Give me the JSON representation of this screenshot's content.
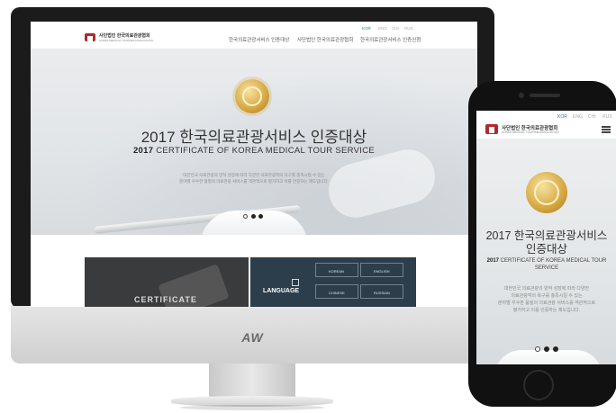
{
  "site": {
    "logo_text": "사단법인 한국의료관광협회",
    "logo_sub": "KOREA MEDICAL TOURISM ASSOCIATION"
  },
  "desktop": {
    "languages": [
      "KOR",
      "ENG",
      "CHI",
      "RUS"
    ],
    "nav": [
      "한국의료관광서비스 인증대상",
      "사단법인 한국의료관광협회",
      "한국의료관광서비스 인증신청"
    ],
    "hero": {
      "title": "2017 한국의료관광서비스 인증대상",
      "subtitle_year": "2017",
      "subtitle": "CERTIFICATE OF KOREA MEDICAL TOUR SERVICE",
      "desc_line1": "대한민국 의료관광의 양적 성장에 따라 다양한 의료관광객의 욕구를 충족시킬 수 있는",
      "desc_line2": "분야별 우수한 품질의 의료관광 서비스를 객관적으로 평가하고 이를 인증하는 제도입니다."
    },
    "tiles": {
      "left_label": "CERTIFICATE",
      "language_title": "LANGUAGE",
      "language_options": [
        "KOREAN",
        "ENGLISH",
        "CHINESE",
        "RUSSIAN"
      ]
    }
  },
  "monitor_logo": "AW",
  "phone": {
    "languages": [
      "KOR",
      "ENG",
      "CHI",
      "RUS"
    ],
    "hero": {
      "title_line1": "2017 한국의료관광서비스",
      "title_line2": "인증대상",
      "subtitle_year": "2017",
      "subtitle_line1": "CERTIFICATE OF KOREA MEDICAL TOUR",
      "subtitle_line2": "SERVICE",
      "desc_line1": "대한민국 의료관광의 양적 성장에 따라 다양한",
      "desc_line2": "의료관광객의 욕구를 충족시킬 수 있는",
      "desc_line3": "분야별 우수한 품질의 의료관광 서비스를 객관적으로",
      "desc_line4": "평가하고 이를 인증하는 제도입니다."
    }
  }
}
